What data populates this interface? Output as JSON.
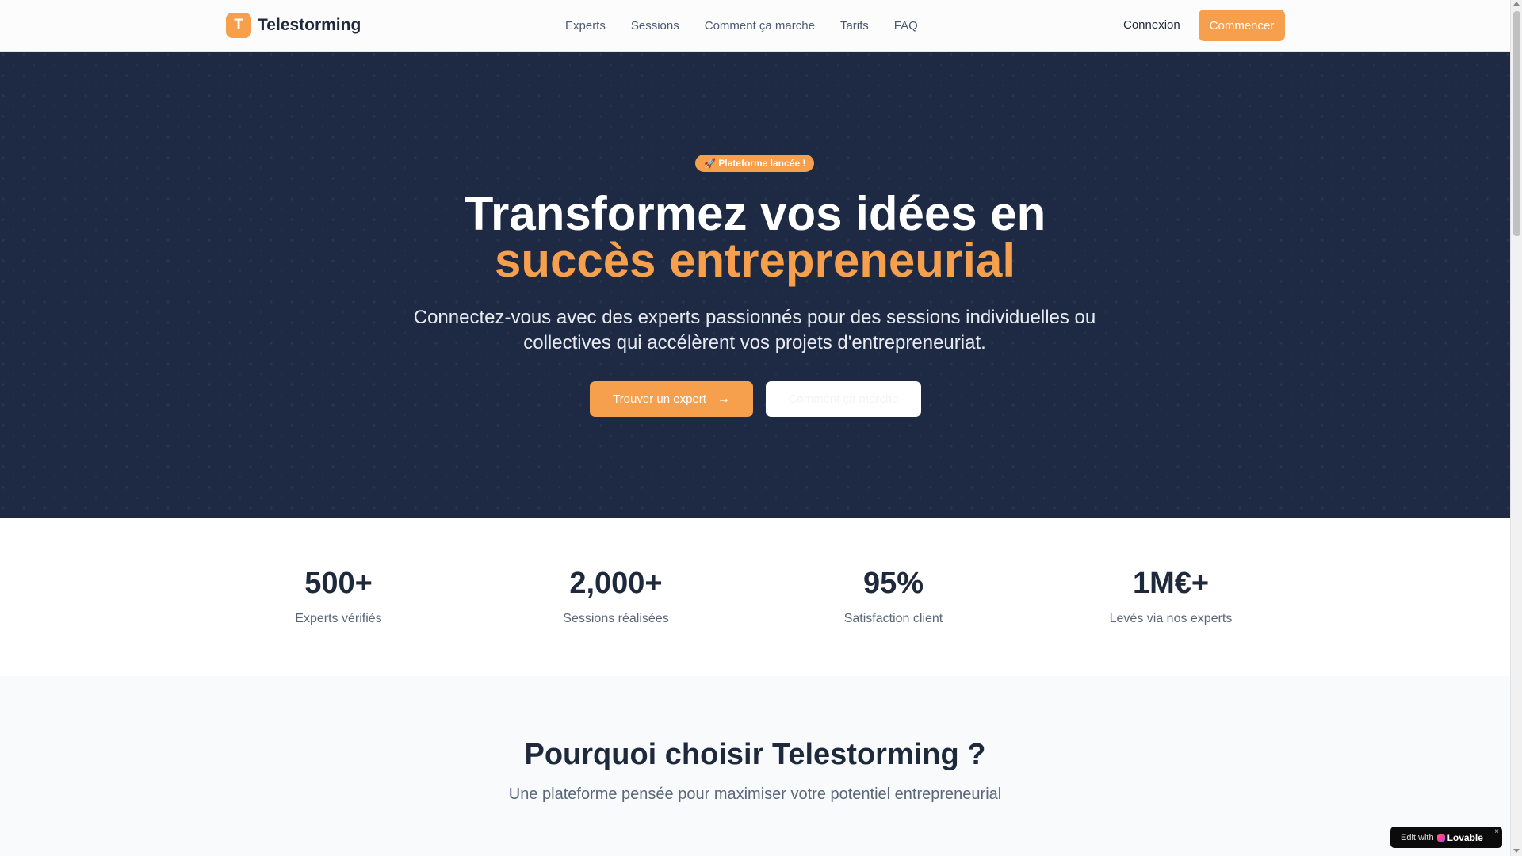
{
  "header": {
    "logo_letter": "T",
    "brand": "Telestorming",
    "nav": [
      "Experts",
      "Sessions",
      "Comment ça marche",
      "Tarifs",
      "FAQ"
    ],
    "login": "Connexion",
    "cta": "Commencer"
  },
  "hero": {
    "badge": "🚀 Plateforme lancée !",
    "title_line1": "Transformez vos idées en",
    "title_line2": "succès entrepreneurial",
    "subtitle": "Connectez-vous avec des experts passionnés pour des sessions individuelles ou collectives qui accélèrent vos projets d'entrepreneuriat.",
    "primary_button": "Trouver un expert",
    "secondary_button": "Comment ça marche"
  },
  "stats": [
    {
      "value": "500+",
      "label": "Experts vérifiés"
    },
    {
      "value": "2,000+",
      "label": "Sessions réalisées"
    },
    {
      "value": "95%",
      "label": "Satisfaction client"
    },
    {
      "value": "1M€+",
      "label": "Levés via nos experts"
    }
  ],
  "why": {
    "title": "Pourquoi choisir Telestorming ?",
    "subtitle": "Une plateforme pensée pour maximiser votre potentiel entrepreneurial"
  },
  "lovable_badge": {
    "edit": "Edit with",
    "brand": "Lovable",
    "close": "×"
  },
  "colors": {
    "accent": "#f6a04d",
    "hero_bg": "#1e2a44",
    "text_dark": "#1e293b"
  }
}
